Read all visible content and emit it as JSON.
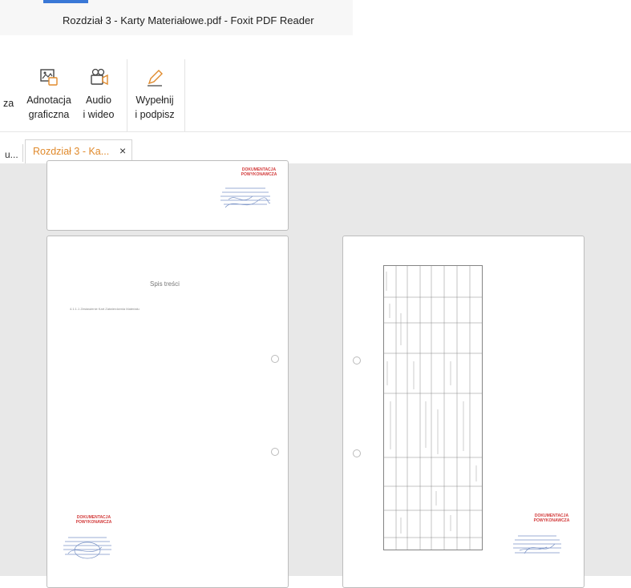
{
  "window": {
    "title": "Rozdział 3 - Karty Materiałowe.pdf - Foxit PDF Reader"
  },
  "ribbon": {
    "partial_label": "za",
    "buttons": [
      {
        "line1": "Adnotacja",
        "line2": "graficzna",
        "icon": "image-annotation-icon"
      },
      {
        "line1": "Audio",
        "line2": "i wideo",
        "icon": "video-camera-icon"
      },
      {
        "line1": "Wypełnij",
        "line2": "i podpisz",
        "icon": "pen-sign-icon"
      }
    ]
  },
  "tabs": {
    "previous_label": "u...",
    "active_label": "Rozdział 3 - Ka...",
    "close_glyph": "×",
    "active_color": "#e08a2c"
  },
  "document": {
    "stamp": "DOKUMENTACJA POWYKONAWCZA",
    "toc_title": "Spis treści",
    "toc_entry": "4.1.1.1 Zestawienie Kart Zatwierdzenia Materiału",
    "stamp_color": "#d23a3a"
  }
}
